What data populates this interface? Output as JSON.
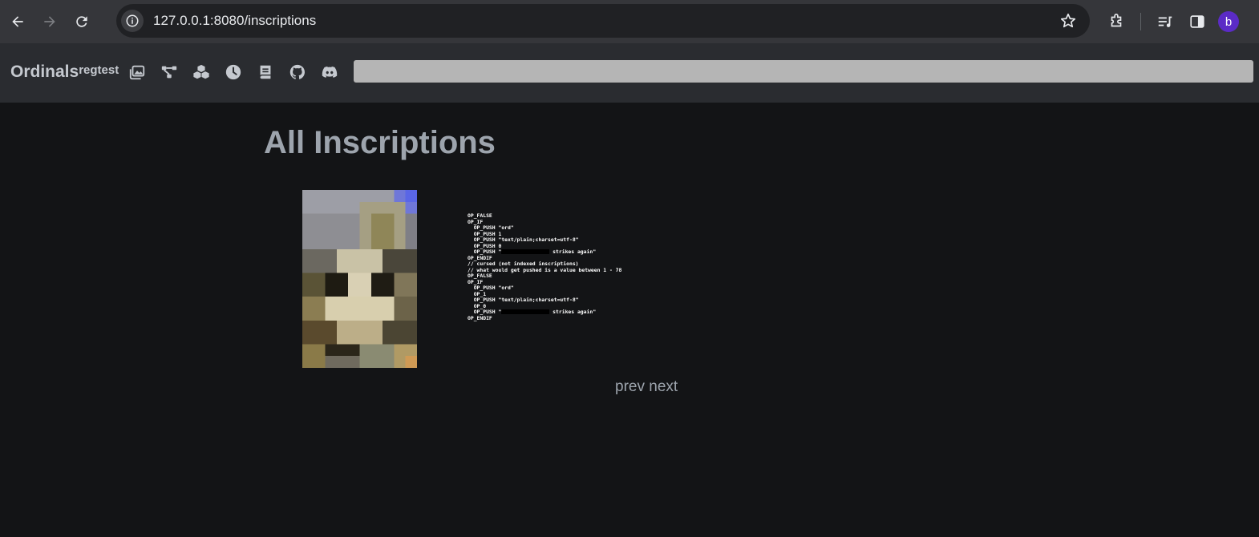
{
  "browser": {
    "url_host": "127.0.0.1",
    "url_port_path": ":8080/inscriptions",
    "profile_initial": "b"
  },
  "site": {
    "brand": "Ordinals",
    "network": "regtest",
    "icons": [
      "gallery-icon",
      "nodes-icon",
      "cubes-icon",
      "clock-icon",
      "book-icon",
      "github-icon",
      "discord-icon"
    ],
    "search_value": ""
  },
  "page": {
    "title": "All Inscriptions"
  },
  "inscriptions": {
    "code_lines": [
      "OP_FALSE",
      "OP_IF",
      "  OP_PUSH \"ord\"",
      "  OP_PUSH 1",
      "  OP_PUSH \"text/plain;charset=utf-8\"",
      "  OP_PUSH 0",
      "  OP_PUSH \"",
      "OP_ENDIF",
      "",
      "",
      "",
      "// cursed (not indexed inscriptions)",
      "// what would get pushed is a value between 1 - 78",
      "OP_FALSE",
      "OP_IF",
      "  OP_PUSH \"ord\"",
      "  OP_1",
      "  OP_PUSH \"text/plain;charset=utf-8\"",
      "  OP_0",
      "  OP_PUSH \"",
      "OP_ENDIF"
    ],
    "strikes_suffix": " strikes again\""
  },
  "pager": {
    "prev": "prev",
    "next": "next"
  },
  "colors": {
    "background": "#131416",
    "header": "#2a2c30",
    "title": "#9da4ad"
  }
}
